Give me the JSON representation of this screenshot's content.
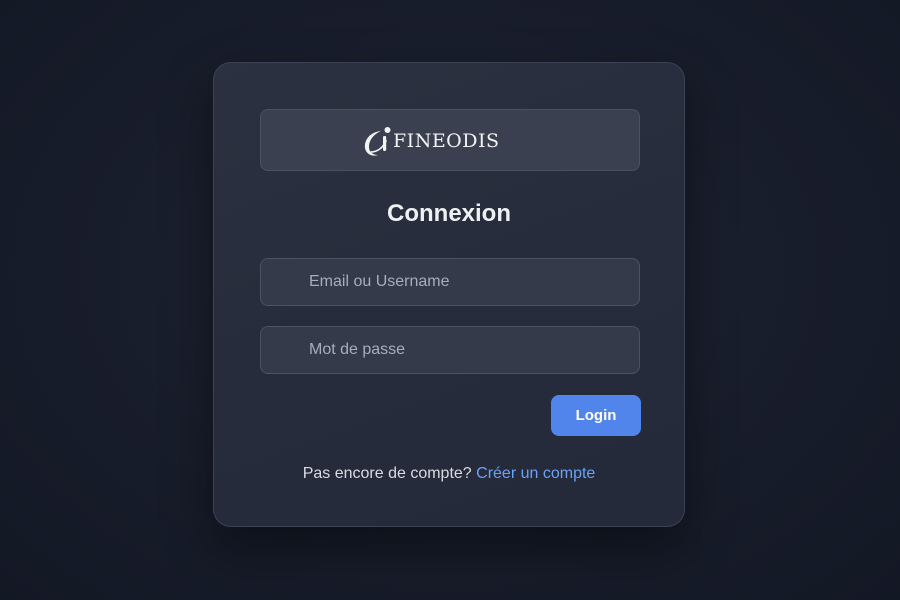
{
  "brand": {
    "logo_text": "FINEODIS",
    "logo_icon": "fineodis-swoosh-logo"
  },
  "login_form": {
    "title": "Connexion",
    "email_placeholder": "Email ou Username",
    "email_value": "",
    "password_placeholder": "Mot de passe",
    "password_value": "",
    "submit_label": "Login"
  },
  "signup": {
    "prompt": "Pas encore de compte?",
    "link_label": "Créer un compte"
  },
  "colors": {
    "background": "#181d2b",
    "card": "#262c3b",
    "accent": "#5285ec",
    "link": "#6aa2f4",
    "text": "#eef0f4"
  }
}
